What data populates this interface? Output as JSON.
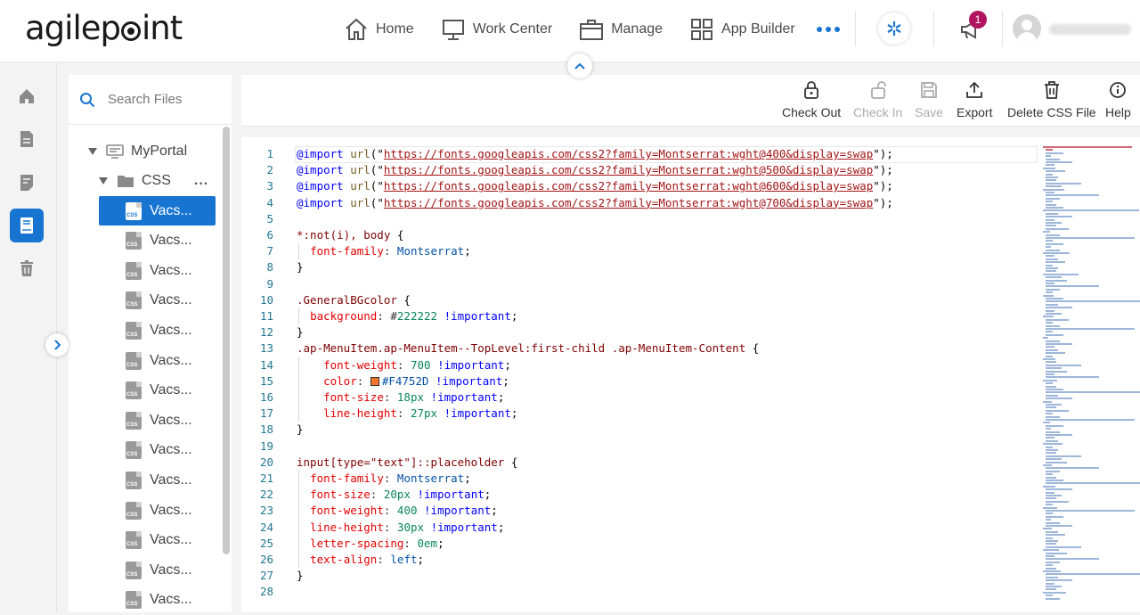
{
  "header": {
    "logo_text": "agilepoint",
    "nav": [
      {
        "label": "Home",
        "icon": "home-icon"
      },
      {
        "label": "Work Center",
        "icon": "monitor-icon"
      },
      {
        "label": "Manage",
        "icon": "briefcase-icon"
      },
      {
        "label": "App Builder",
        "icon": "grid-icon"
      }
    ],
    "more_icon": "more-dots-icon",
    "notification_count": "1",
    "accent_color": "#1874d1",
    "badge_color": "#b0145e"
  },
  "rail": {
    "items": [
      "home-icon",
      "document-icon",
      "form-icon",
      "book-icon",
      "trash-icon"
    ],
    "active_index": 3
  },
  "file_panel": {
    "search_placeholder": "Search Files",
    "root_label": "MyPortal",
    "folder_label": "CSS",
    "folder_more": "...",
    "file_icon_text": "CSS",
    "files": [
      "Vacs...",
      "Vacs...",
      "Vacs...",
      "Vacs...",
      "Vacs...",
      "Vacs...",
      "Vacs...",
      "Vacs...",
      "Vacs...",
      "Vacs...",
      "Vacs...",
      "Vacs...",
      "Vacs...",
      "Vacs..."
    ],
    "active_file_index": 0
  },
  "toolbar": {
    "buttons": [
      {
        "label": "Check Out",
        "enabled": true,
        "icon": "lock-icon"
      },
      {
        "label": "Check In",
        "enabled": false,
        "icon": "unlock-icon"
      },
      {
        "label": "Save",
        "enabled": false,
        "icon": "save-icon"
      },
      {
        "label": "Export",
        "enabled": true,
        "icon": "export-icon"
      },
      {
        "label": "Delete CSS File",
        "enabled": true,
        "icon": "trash-icon"
      },
      {
        "label": "Help",
        "enabled": true,
        "icon": "info-icon"
      }
    ]
  },
  "editor": {
    "lines": [
      {
        "n": "1",
        "text": "@import url(\"https://fonts.googleapis.com/css2?family=Montserrat:wght@400&display=swap\");"
      },
      {
        "n": "2",
        "text": "@import url(\"https://fonts.googleapis.com/css2?family=Montserrat:wght@500&display=swap\");"
      },
      {
        "n": "3",
        "text": "@import url(\"https://fonts.googleapis.com/css2?family=Montserrat:wght@600&display=swap\");"
      },
      {
        "n": "4",
        "text": "@import url(\"https://fonts.googleapis.com/css2?family=Montserrat:wght@700&display=swap\");"
      },
      {
        "n": "5",
        "text": ""
      },
      {
        "n": "6",
        "text": "*:not(i), body {"
      },
      {
        "n": "7",
        "text": "  font-family: Montserrat;"
      },
      {
        "n": "8",
        "text": "}"
      },
      {
        "n": "9",
        "text": ""
      },
      {
        "n": "10",
        "text": ".GeneralBGcolor {"
      },
      {
        "n": "11",
        "text": "  background: #222222 !important;"
      },
      {
        "n": "12",
        "text": "}"
      },
      {
        "n": "13",
        "text": ".ap-MenuItem.ap-MenuItem--TopLevel:first-child .ap-MenuItem-Content {"
      },
      {
        "n": "14",
        "text": "    font-weight: 700 !important;"
      },
      {
        "n": "15",
        "text": "    color: #F4752D !important;"
      },
      {
        "n": "16",
        "text": "    font-size: 18px !important;"
      },
      {
        "n": "17",
        "text": "    line-height: 27px !important;"
      },
      {
        "n": "18",
        "text": "}"
      },
      {
        "n": "19",
        "text": ""
      },
      {
        "n": "20",
        "text": "input[type=\"text\"]::placeholder {"
      },
      {
        "n": "21",
        "text": "  font-family: Montserrat;"
      },
      {
        "n": "22",
        "text": "  font-size: 20px !important;"
      },
      {
        "n": "23",
        "text": "  font-weight: 400 !important;"
      },
      {
        "n": "24",
        "text": "  line-height: 30px !important;"
      },
      {
        "n": "25",
        "text": "  letter-spacing: 0em;"
      },
      {
        "n": "26",
        "text": "  text-align: left;"
      },
      {
        "n": "27",
        "text": "}"
      },
      {
        "n": "28",
        "text": ""
      }
    ],
    "swatches": {
      "11": "#222222",
      "15": "#F4752D"
    }
  }
}
